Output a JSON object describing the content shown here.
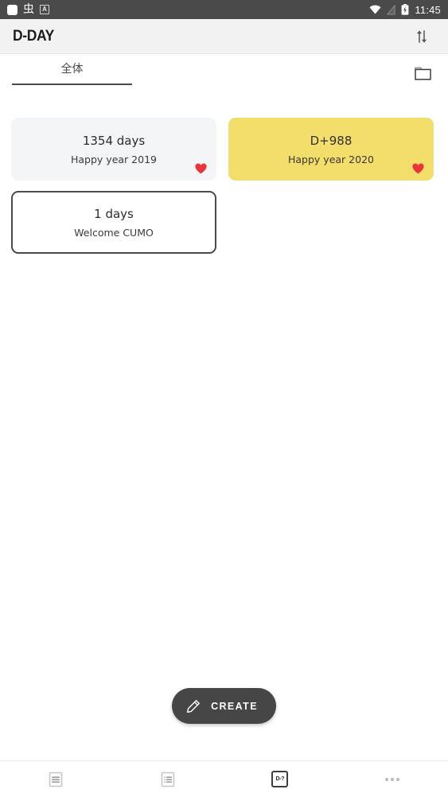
{
  "statusbar": {
    "icons_left": [
      "app-square-icon",
      "ime-glyph-icon",
      "keyboard-a-icon"
    ],
    "ime_glyph": "虫",
    "a_label": "A",
    "icons_right": [
      "wifi-icon",
      "signal-icon",
      "battery-charging-icon"
    ],
    "time": "11:45"
  },
  "appbar": {
    "title": "D-DAY",
    "sort_icon": "sort-arrows-icon"
  },
  "tabs": {
    "items": [
      {
        "label": "全体",
        "active": true
      }
    ],
    "folder_icon": "folder-icon"
  },
  "cards": [
    {
      "days": "1354 days",
      "title": "Happy year 2019",
      "style": "light",
      "favorite": true,
      "heart_icon": "heart-icon"
    },
    {
      "days": "D+988",
      "title": "Happy year 2020",
      "style": "yellow",
      "favorite": true,
      "heart_icon": "heart-icon"
    },
    {
      "days": "1 days",
      "title": "Welcome CUMO",
      "style": "outline",
      "favorite": false,
      "heart_icon": ""
    }
  ],
  "fab": {
    "label": "CREATE",
    "icon": "pencil-icon"
  },
  "bottomnav": {
    "items": [
      {
        "name": "list-icon",
        "label": "",
        "active": false
      },
      {
        "name": "bulleted-list-icon",
        "label": "",
        "active": false
      },
      {
        "name": "dday-icon",
        "label": "D-?",
        "active": true
      },
      {
        "name": "more-icon",
        "label": "",
        "active": false
      }
    ]
  },
  "colors": {
    "statusbar_bg": "#4a4a4a",
    "appbar_bg": "#f2f2f2",
    "card_light": "#f4f5f7",
    "card_yellow": "#f4de6b",
    "card_outline_border": "#4a4a4a",
    "heart_red": "#e8343a",
    "fab_bg": "#464646",
    "text_dark": "#2b2b2b"
  }
}
